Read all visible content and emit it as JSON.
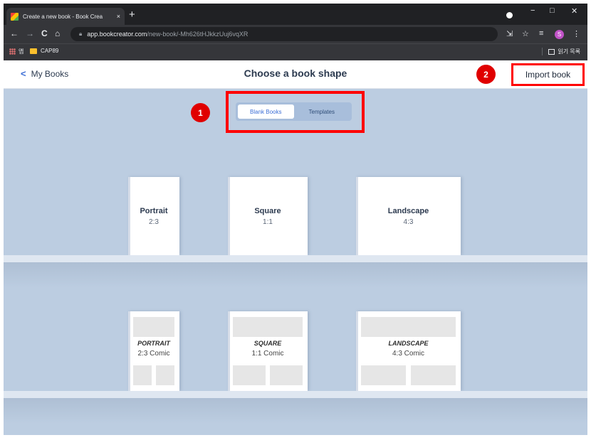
{
  "browser": {
    "tab_title": "Create a new book - Book Crea",
    "tab_close": "×",
    "new_tab": "+",
    "url_host": "app.bookcreator.com",
    "url_path": "/new-book/-Mh626tHJkkzUuj6vqXR",
    "profile_initial": "S",
    "bookmarks": [
      {
        "label": "앱",
        "icon": "apps-grid-icon"
      },
      {
        "label": "CAP89",
        "icon": "folder-icon"
      }
    ],
    "reading_list": "읽기 목록",
    "window_controls": {
      "minimize": "−",
      "maximize": "□",
      "close": "✕"
    },
    "nav": {
      "back": "←",
      "forward": "→",
      "reload": "C",
      "home": "⌂"
    }
  },
  "header": {
    "back_chevron": "<",
    "back_label": "My Books",
    "title": "Choose a book shape",
    "import_label": "Import book"
  },
  "segment": {
    "options": [
      {
        "label": "Blank Books",
        "active": true
      },
      {
        "label": "Templates",
        "active": false
      }
    ]
  },
  "annotations": {
    "badge1": "1",
    "badge2": "2",
    "highlight_color": "#ff0000"
  },
  "books": [
    {
      "name": "Portrait",
      "ratio": "2:3"
    },
    {
      "name": "Square",
      "ratio": "1:1"
    },
    {
      "name": "Landscape",
      "ratio": "4:3"
    }
  ],
  "comics": [
    {
      "name": "PORTRAIT",
      "ratio": "2:3 Comic"
    },
    {
      "name": "SQUARE",
      "ratio": "1:1 Comic"
    },
    {
      "name": "LANDSCAPE",
      "ratio": "4:3 Comic"
    }
  ],
  "colors": {
    "accent": "#3d6fd6",
    "stage_bg": "#bccde1",
    "badge": "#e00000"
  }
}
